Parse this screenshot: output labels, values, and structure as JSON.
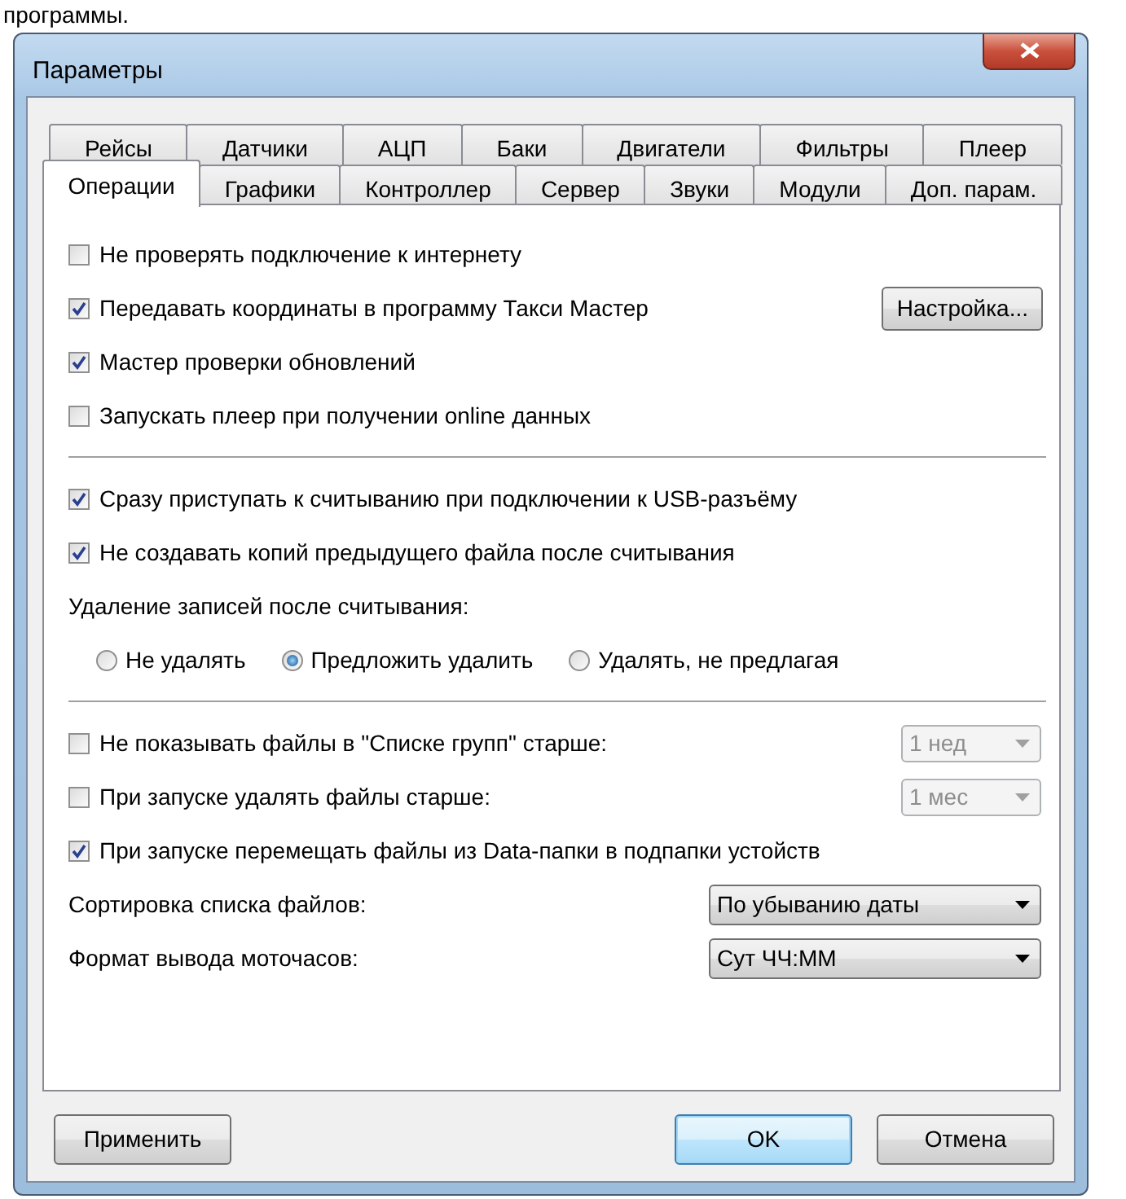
{
  "background_text": "программы.",
  "window": {
    "title": "Параметры"
  },
  "tab_rows": [
    {
      "tabs": [
        {
          "label": "Рейсы",
          "selected": false
        },
        {
          "label": "Датчики",
          "selected": false
        },
        {
          "label": "АЦП",
          "selected": false
        },
        {
          "label": "Баки",
          "selected": false
        },
        {
          "label": "Двигатели",
          "selected": false
        },
        {
          "label": "Фильтры",
          "selected": false
        },
        {
          "label": "Плеер",
          "selected": false
        }
      ]
    },
    {
      "tabs": [
        {
          "label": "Операции",
          "selected": true
        },
        {
          "label": "Графики",
          "selected": false
        },
        {
          "label": "Контроллер",
          "selected": false
        },
        {
          "label": "Сервер",
          "selected": false
        },
        {
          "label": "Звуки",
          "selected": false
        },
        {
          "label": "Модули",
          "selected": false
        },
        {
          "label": "Доп. парам.",
          "selected": false
        }
      ]
    }
  ],
  "items": [
    {
      "kind": "checkbox",
      "label": "Не проверять подключение к интернету",
      "checked": false
    },
    {
      "kind": "checkbox",
      "label": "Передавать координаты в программу Такси Мастер",
      "checked": true,
      "button": "Настройка..."
    },
    {
      "kind": "checkbox",
      "label": "Мастер проверки обновлений",
      "checked": true
    },
    {
      "kind": "checkbox",
      "label": "Запускать плеер при получении online данных",
      "checked": false
    },
    {
      "kind": "divider"
    },
    {
      "kind": "checkbox",
      "label": "Сразу приступать к считыванию при подключении к USB-разъёму",
      "checked": true
    },
    {
      "kind": "checkbox",
      "label": "Не создавать копий предыдущего файла после считывания",
      "checked": true
    },
    {
      "kind": "label",
      "text": "Удаление записей после считывания:"
    },
    {
      "kind": "radio_group",
      "options": [
        {
          "label": "Не удалять",
          "selected": false
        },
        {
          "label": "Предложить удалить",
          "selected": true
        },
        {
          "label": "Удалять, не предлагая",
          "selected": false
        }
      ]
    },
    {
      "kind": "divider"
    },
    {
      "kind": "checkbox",
      "label": "Не показывать файлы в \"Списке групп\" старше:",
      "checked": false,
      "dropdown": {
        "value": "1 нед",
        "disabled": true
      }
    },
    {
      "kind": "checkbox",
      "label": "При запуске удалять файлы старше:",
      "checked": false,
      "dropdown": {
        "value": "1 мес",
        "disabled": true
      }
    },
    {
      "kind": "checkbox",
      "label": "При запуске перемещать файлы из Data-папки в подпапки устойств",
      "checked": true
    },
    {
      "kind": "select",
      "label": "Сортировка списка файлов:",
      "value": "По убыванию даты"
    },
    {
      "kind": "select",
      "label": "Формат вывода моточасов:",
      "value": "Сут ЧЧ:ММ"
    }
  ],
  "footer": {
    "left": [
      {
        "label": "Применить",
        "default": false
      }
    ],
    "right": [
      {
        "label": "OK",
        "default": true
      },
      {
        "label": "Отмена",
        "default": false
      }
    ]
  }
}
